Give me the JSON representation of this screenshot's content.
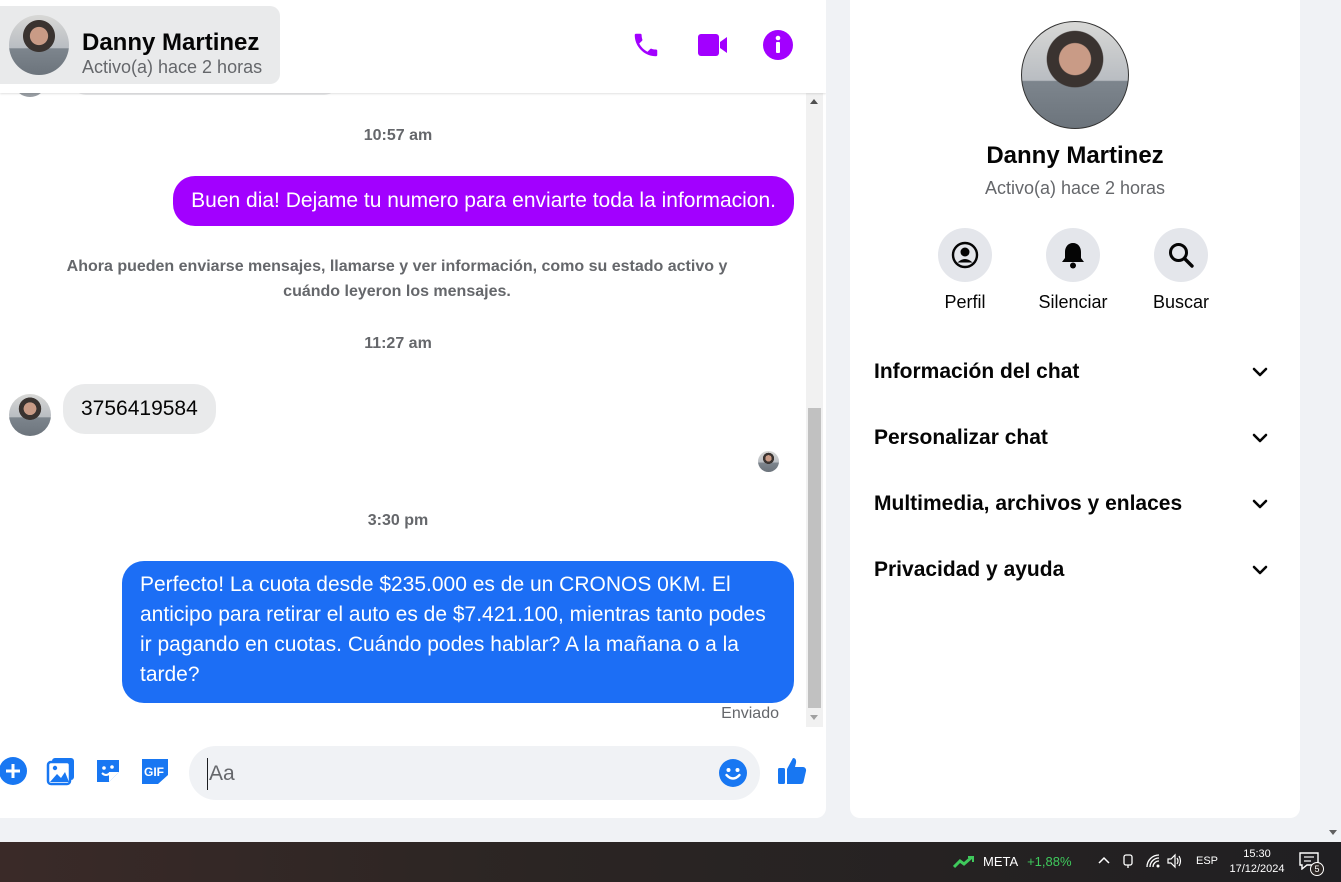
{
  "header": {
    "contact_name": "Danny Martinez",
    "contact_status": "Activo(a) hace 2 horas",
    "icons": [
      "phone-icon",
      "video-call-icon",
      "info-icon"
    ],
    "accent_color": "#a200ff"
  },
  "messages": {
    "ts1": "10:57 am",
    "out1": "Buen dia! Dejame tu numero para enviarte toda la informacion.",
    "system_note": "Ahora pueden enviarse mensajes, llamarse y ver información, como su estado activo y cuándo leyeron los mensajes.",
    "ts2": "11:27 am",
    "in1": "3756419584",
    "ts3": "3:30 pm",
    "out2": "Perfecto! La cuota desde $235.000 es de un CRONOS 0KM. El anticipo para retirar el auto es de $7.421.100, mientras tanto podes ir pagando en cuotas. Cuándo podes hablar? A la mañana o a la tarde?",
    "status": "Enviado",
    "bubble_color_1": "#a200ff",
    "bubble_color_2": "#1877f2"
  },
  "composer": {
    "placeholder": "Aa",
    "icons": [
      "plus-icon",
      "image-icon",
      "sticker-icon",
      "gif-icon",
      "emoji-icon",
      "like-icon"
    ],
    "gif_label": "GIF"
  },
  "info_panel": {
    "name": "Danny Martinez",
    "status": "Activo(a) hace 2 horas",
    "actions": [
      {
        "label": "Perfil",
        "icon": "profile-icon"
      },
      {
        "label": "Silenciar",
        "icon": "bell-icon"
      },
      {
        "label": "Buscar",
        "icon": "search-icon"
      }
    ],
    "sections": [
      "Información del chat",
      "Personalizar chat",
      "Multimedia, archivos y enlaces",
      "Privacidad y ayuda"
    ]
  },
  "taskbar": {
    "stock_name": "META",
    "stock_change": "+1,88%",
    "language": "ESP",
    "time": "15:30",
    "date": "17/12/2024",
    "notification_count": "5"
  }
}
